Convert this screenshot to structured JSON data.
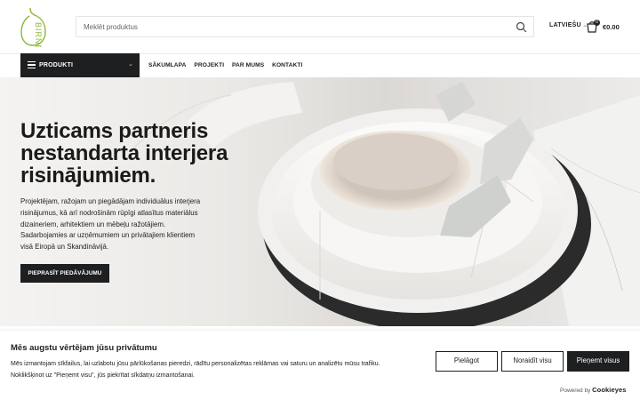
{
  "header": {
    "logo_text": "BIRNE",
    "search_placeholder": "Meklēt produktus",
    "language": "LATVIEŠU",
    "cart_count": "0",
    "cart_total": "€0.00"
  },
  "nav": {
    "products_label": "PRODUKTI",
    "items": [
      {
        "label": "SĀKUMLAPA"
      },
      {
        "label": "PROJEKTI"
      },
      {
        "label": "PAR MUMS"
      },
      {
        "label": "KONTAKTI"
      }
    ]
  },
  "hero": {
    "title_lines": [
      "Uzticams partneris",
      "nestandarta interjera",
      "risinājumiem."
    ],
    "text_lines": [
      "Projektējam, ražojam un piegādājam individuālus interjera",
      "risinājumus, kā arī nodrošinām rūpīgi atlasītus materiālus",
      "dizaineriem, arhitektiem un mēbeļu ražotājiem.",
      "Sadarbojamies ar uzņēmumiem un privātajiem klientiem",
      "visā Eiropā un Skandināvijā."
    ],
    "cta_label": "PIEPRASĪT PIEDĀVĀJUMU"
  },
  "cookie": {
    "title": "Mēs augstu vērtējam jūsu privātumu",
    "text_lines": [
      "Mēs izmantojam sīkfailus, lai uzlabotu jūsu pārlūkošanas pieredzi, rādītu personalizētas reklāmas vai saturu un analizētu mūsu trafiku.",
      "Noklikšķinot uz \"Pieņemt visu\", jūs piekrītat sīkdatņu izmantošanai."
    ],
    "customize_label": "Pielāgot",
    "reject_label": "Noraidīt visu",
    "accept_label": "Pieņemt visus",
    "powered_prefix": "Powered by",
    "powered_brand": "Cookieyes"
  },
  "colors": {
    "accent_green": "#8bb83a",
    "dark": "#1d1f21"
  }
}
